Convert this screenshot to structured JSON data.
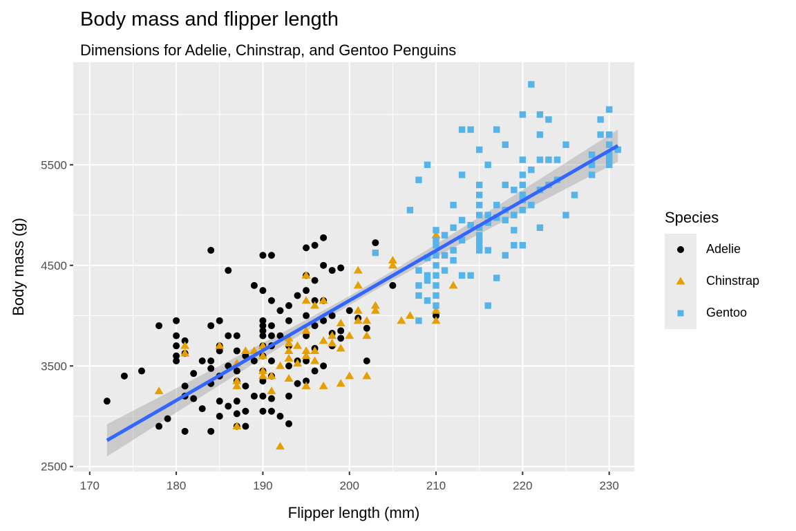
{
  "chart_data": {
    "type": "scatter",
    "title": "Body mass and flipper length",
    "subtitle": "Dimensions for Adelie, Chinstrap, and Gentoo Penguins",
    "xlabel": "Flipper length (mm)",
    "ylabel": "Body mass (g)",
    "xlim": [
      168.1,
      232.9
    ],
    "ylim": [
      2450,
      6520
    ],
    "x_ticks": [
      170,
      180,
      190,
      200,
      210,
      220,
      230
    ],
    "y_ticks": [
      2500,
      3500,
      4500,
      5500
    ],
    "grid": true,
    "legend": {
      "title": "Species",
      "placement": "right",
      "entries": [
        {
          "label": "Adelie",
          "shape": "circle",
          "color": "#000000"
        },
        {
          "label": "Chinstrap",
          "shape": "triangle",
          "color": "#E69F00"
        },
        {
          "label": "Gentoo",
          "shape": "square",
          "color": "#56B4E9"
        }
      ]
    },
    "trend": {
      "type": "linear",
      "color": "#3366FF",
      "x_range": [
        172,
        231
      ],
      "y_at_start": 2760,
      "y_at_end": 5690,
      "ci_halfwidth_ends": 160,
      "ci_halfwidth_mid": 45
    },
    "series": [
      {
        "name": "Adelie",
        "points": [
          [
            172,
            3150
          ],
          [
            174,
            3400
          ],
          [
            176,
            3450
          ],
          [
            178,
            3900
          ],
          [
            178,
            2900
          ],
          [
            179,
            2975
          ],
          [
            180,
            3950
          ],
          [
            180,
            3600
          ],
          [
            180,
            3550
          ],
          [
            180,
            3700
          ],
          [
            180,
            3800
          ],
          [
            181,
            3750
          ],
          [
            181,
            3625
          ],
          [
            181,
            3200
          ],
          [
            181,
            2850
          ],
          [
            181,
            3300
          ],
          [
            182,
            3175
          ],
          [
            182,
            3425
          ],
          [
            183,
            3550
          ],
          [
            183,
            3075
          ],
          [
            184,
            4650
          ],
          [
            184,
            3900
          ],
          [
            184,
            3550
          ],
          [
            184,
            3475
          ],
          [
            184,
            3325
          ],
          [
            184,
            2850
          ],
          [
            185,
            3950
          ],
          [
            185,
            3700
          ],
          [
            185,
            3650
          ],
          [
            185,
            3400
          ],
          [
            185,
            3150
          ],
          [
            185,
            3000
          ],
          [
            186,
            4450
          ],
          [
            186,
            3800
          ],
          [
            186,
            3500
          ],
          [
            186,
            3100
          ],
          [
            187,
            3800
          ],
          [
            187,
            3650
          ],
          [
            187,
            3450
          ],
          [
            187,
            3350
          ],
          [
            187,
            3150
          ],
          [
            187,
            3025
          ],
          [
            187,
            2900
          ],
          [
            188,
            3600
          ],
          [
            188,
            3300
          ],
          [
            188,
            3050
          ],
          [
            188,
            2900
          ],
          [
            189,
            4300
          ],
          [
            189,
            3550
          ],
          [
            189,
            3200
          ],
          [
            190,
            4600
          ],
          [
            190,
            4250
          ],
          [
            190,
            3950
          ],
          [
            190,
            3900
          ],
          [
            190,
            3850
          ],
          [
            190,
            3800
          ],
          [
            190,
            3700
          ],
          [
            190,
            3600
          ],
          [
            190,
            3450
          ],
          [
            190,
            3350
          ],
          [
            190,
            3200
          ],
          [
            190,
            3050
          ],
          [
            191,
            4600
          ],
          [
            191,
            4150
          ],
          [
            191,
            3900
          ],
          [
            191,
            3800
          ],
          [
            191,
            3700
          ],
          [
            191,
            3550
          ],
          [
            191,
            3400
          ],
          [
            191,
            3175
          ],
          [
            191,
            3050
          ],
          [
            192,
            4050
          ],
          [
            192,
            3800
          ],
          [
            192,
            3000
          ],
          [
            193,
            4100
          ],
          [
            193,
            3950
          ],
          [
            193,
            3700
          ],
          [
            193,
            3500
          ],
          [
            193,
            3200
          ],
          [
            193,
            2925
          ],
          [
            194,
            4200
          ],
          [
            194,
            3550
          ],
          [
            194,
            3325
          ],
          [
            195,
            4675
          ],
          [
            195,
            4400
          ],
          [
            195,
            4250
          ],
          [
            195,
            4000
          ],
          [
            195,
            3800
          ],
          [
            195,
            3550
          ],
          [
            195,
            3350
          ],
          [
            196,
            4700
          ],
          [
            196,
            4350
          ],
          [
            196,
            4150
          ],
          [
            196,
            3900
          ],
          [
            196,
            3675
          ],
          [
            196,
            3450
          ],
          [
            197,
            4775
          ],
          [
            197,
            4500
          ],
          [
            197,
            4150
          ],
          [
            197,
            3950
          ],
          [
            197,
            3500
          ],
          [
            198,
            4450
          ],
          [
            198,
            4000
          ],
          [
            198,
            3825
          ],
          [
            198,
            3700
          ],
          [
            199,
            4475
          ],
          [
            199,
            3850
          ],
          [
            199,
            3775
          ],
          [
            200,
            4050
          ],
          [
            201,
            3975
          ],
          [
            202,
            3875
          ],
          [
            202,
            3550
          ],
          [
            203,
            4725
          ],
          [
            205,
            4300
          ],
          [
            210,
            4000
          ]
        ]
      },
      {
        "name": "Chinstrap",
        "points": [
          [
            178,
            3250
          ],
          [
            181,
            3700
          ],
          [
            181,
            3625
          ],
          [
            185,
            3700
          ],
          [
            187,
            3350
          ],
          [
            187,
            3300
          ],
          [
            187,
            2900
          ],
          [
            187,
            3525
          ],
          [
            188,
            3650
          ],
          [
            189,
            3650
          ],
          [
            190,
            3700
          ],
          [
            190,
            3600
          ],
          [
            190,
            3450
          ],
          [
            190,
            3400
          ],
          [
            191,
            3400
          ],
          [
            191,
            3250
          ],
          [
            192,
            3500
          ],
          [
            192,
            2700
          ],
          [
            193,
            3775
          ],
          [
            193,
            3725
          ],
          [
            193,
            3650
          ],
          [
            193,
            3575
          ],
          [
            193,
            3375
          ],
          [
            194,
            3700
          ],
          [
            194,
            3525
          ],
          [
            195,
            4400
          ],
          [
            195,
            4150
          ],
          [
            195,
            3850
          ],
          [
            195,
            3650
          ],
          [
            195,
            3600
          ],
          [
            195,
            3300
          ],
          [
            196,
            4100
          ],
          [
            196,
            3650
          ],
          [
            196,
            3550
          ],
          [
            197,
            4150
          ],
          [
            197,
            3750
          ],
          [
            197,
            3300
          ],
          [
            198,
            3800
          ],
          [
            198,
            3725
          ],
          [
            199,
            3925
          ],
          [
            199,
            3675
          ],
          [
            199,
            3325
          ],
          [
            200,
            3800
          ],
          [
            200,
            3400
          ],
          [
            201,
            4450
          ],
          [
            201,
            4300
          ],
          [
            201,
            4050
          ],
          [
            201,
            3950
          ],
          [
            202,
            3950
          ],
          [
            202,
            3800
          ],
          [
            202,
            3400
          ],
          [
            203,
            4100
          ],
          [
            203,
            4050
          ],
          [
            205,
            4550
          ],
          [
            205,
            4500
          ],
          [
            206,
            3950
          ],
          [
            207,
            4000
          ],
          [
            210,
            4800
          ],
          [
            210,
            4050
          ],
          [
            210,
            3950
          ],
          [
            212,
            4300
          ]
        ]
      },
      {
        "name": "Gentoo",
        "points": [
          [
            203,
            4625
          ],
          [
            207,
            5050
          ],
          [
            208,
            5350
          ],
          [
            208,
            4450
          ],
          [
            208,
            4300
          ],
          [
            208,
            4200
          ],
          [
            208,
            3950
          ],
          [
            209,
            5500
          ],
          [
            209,
            4575
          ],
          [
            209,
            4400
          ],
          [
            209,
            4350
          ],
          [
            209,
            4150
          ],
          [
            210,
            4850
          ],
          [
            210,
            4750
          ],
          [
            210,
            4700
          ],
          [
            210,
            4600
          ],
          [
            210,
            4500
          ],
          [
            210,
            4400
          ],
          [
            210,
            4300
          ],
          [
            210,
            4200
          ],
          [
            210,
            4100
          ],
          [
            211,
            4800
          ],
          [
            211,
            4600
          ],
          [
            211,
            4450
          ],
          [
            212,
            5100
          ],
          [
            212,
            4875
          ],
          [
            212,
            4650
          ],
          [
            212,
            4550
          ],
          [
            213,
            5850
          ],
          [
            213,
            5400
          ],
          [
            213,
            4950
          ],
          [
            213,
            4750
          ],
          [
            213,
            4400
          ],
          [
            214,
            5850
          ],
          [
            214,
            4900
          ],
          [
            214,
            4400
          ],
          [
            215,
            5650
          ],
          [
            215,
            5300
          ],
          [
            215,
            5200
          ],
          [
            215,
            5100
          ],
          [
            215,
            5000
          ],
          [
            215,
            4875
          ],
          [
            215,
            4800
          ],
          [
            215,
            4750
          ],
          [
            215,
            4700
          ],
          [
            215,
            4650
          ],
          [
            216,
            5500
          ],
          [
            216,
            5000
          ],
          [
            216,
            4925
          ],
          [
            216,
            4650
          ],
          [
            216,
            4100
          ],
          [
            217,
            5850
          ],
          [
            217,
            5100
          ],
          [
            217,
            4975
          ],
          [
            217,
            4375
          ],
          [
            218,
            5700
          ],
          [
            218,
            5300
          ],
          [
            218,
            5050
          ],
          [
            218,
            4950
          ],
          [
            218,
            4600
          ],
          [
            219,
            5250
          ],
          [
            219,
            5000
          ],
          [
            219,
            4850
          ],
          [
            219,
            4700
          ],
          [
            220,
            6000
          ],
          [
            220,
            5550
          ],
          [
            220,
            5400
          ],
          [
            220,
            5300
          ],
          [
            220,
            5200
          ],
          [
            220,
            5150
          ],
          [
            220,
            5050
          ],
          [
            220,
            4700
          ],
          [
            221,
            6300
          ],
          [
            221,
            5450
          ],
          [
            221,
            5100
          ],
          [
            222,
            6000
          ],
          [
            222,
            5800
          ],
          [
            222,
            5550
          ],
          [
            222,
            5250
          ],
          [
            222,
            4875
          ],
          [
            223,
            5950
          ],
          [
            223,
            5550
          ],
          [
            223,
            5300
          ],
          [
            224,
            5550
          ],
          [
            224,
            5350
          ],
          [
            225,
            5700
          ],
          [
            225,
            5000
          ],
          [
            226,
            5200
          ],
          [
            228,
            5600
          ],
          [
            228,
            5500
          ],
          [
            228,
            5400
          ],
          [
            229,
            5950
          ],
          [
            229,
            5800
          ],
          [
            230,
            6050
          ],
          [
            230,
            5800
          ],
          [
            230,
            5700
          ],
          [
            230,
            5600
          ],
          [
            230,
            5550
          ],
          [
            230,
            5500
          ],
          [
            231,
            5650
          ]
        ]
      }
    ]
  }
}
